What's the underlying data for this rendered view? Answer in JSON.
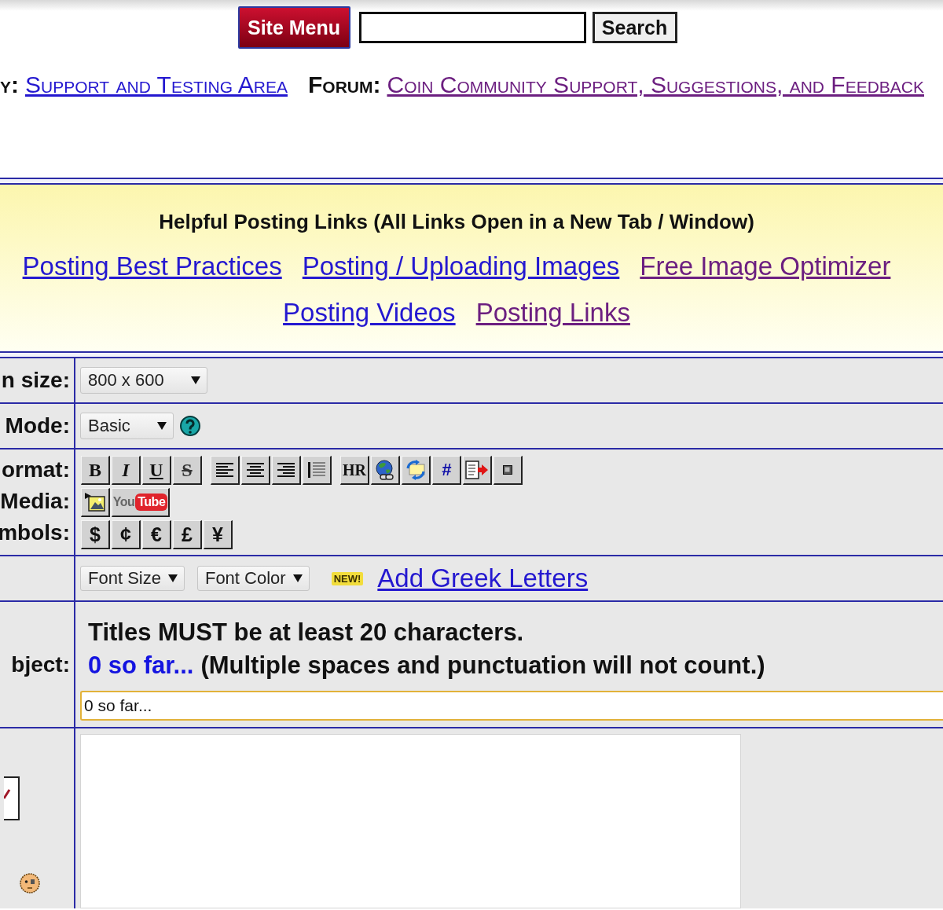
{
  "header": {
    "site_menu": "Site Menu",
    "search_button": "Search"
  },
  "breadcrumb": [
    {
      "label": "y:",
      "link": "Support and Testing Area",
      "visited": false
    },
    {
      "label": "Forum:",
      "link": "Coin Community Support, Suggestions, and Feedback",
      "visited": true
    }
  ],
  "helpful_links": {
    "title": "Helpful Posting Links (All Links Open in a New Tab / Window)",
    "links": [
      {
        "text": "Posting Best Practices",
        "visited": false
      },
      {
        "text": "Posting / Uploading Images",
        "visited": false
      },
      {
        "text": "Free Image Optimizer",
        "visited": true
      },
      {
        "text": "Posting Videos",
        "visited": false
      },
      {
        "text": "Posting Links",
        "visited": true
      }
    ]
  },
  "form": [
    {
      "kind": "select",
      "label": "n size:",
      "value": "800 x 600"
    },
    {
      "kind": "select",
      "label": "Mode:",
      "value": "Basic",
      "help": true
    },
    {
      "kind": "toolbars",
      "toolbars": [
        {
          "label": "ormat:",
          "groups": [
            [
              {
                "kind": "bold",
                "label": "B"
              },
              {
                "kind": "italic",
                "label": "I"
              },
              {
                "kind": "underline",
                "label": "U"
              },
              {
                "kind": "strike",
                "label": "S"
              }
            ],
            [
              {
                "kind": "align-left"
              },
              {
                "kind": "align-center"
              },
              {
                "kind": "align-right"
              },
              {
                "kind": "bar-lines"
              }
            ],
            [
              {
                "kind": "serif",
                "label": "HR"
              },
              {
                "kind": "globe"
              },
              {
                "kind": "swap"
              },
              {
                "kind": "hash",
                "label": "#"
              },
              {
                "kind": "document-arrow"
              },
              {
                "kind": "square"
              }
            ]
          ]
        },
        {
          "label": "Media:",
          "groups": [
            [
              {
                "kind": "picture"
              },
              {
                "kind": "youtube",
                "label": "You",
                "badge": "Tube"
              }
            ]
          ]
        },
        {
          "label": "mbols:",
          "groups": [
            [
              {
                "kind": "symbol",
                "label": "$"
              },
              {
                "kind": "symbol",
                "label": "¢"
              },
              {
                "kind": "symbol",
                "label": "€"
              },
              {
                "kind": "symbol",
                "label": "£"
              },
              {
                "kind": "symbol",
                "label": "¥"
              }
            ]
          ]
        }
      ]
    },
    {
      "kind": "fonts",
      "selects": [
        "Font Size",
        "Font Color"
      ],
      "badge": "NEW!",
      "link": {
        "text": "Add Greek Letters",
        "visited": false
      }
    },
    {
      "kind": "subject",
      "label": "bject:",
      "notice": "Titles MUST be at least 20 characters.",
      "count": "0 so far...",
      "hint": "(Multiple spaces and punctuation will not count.)",
      "value": "0 so far..."
    },
    {
      "kind": "message"
    }
  ]
}
